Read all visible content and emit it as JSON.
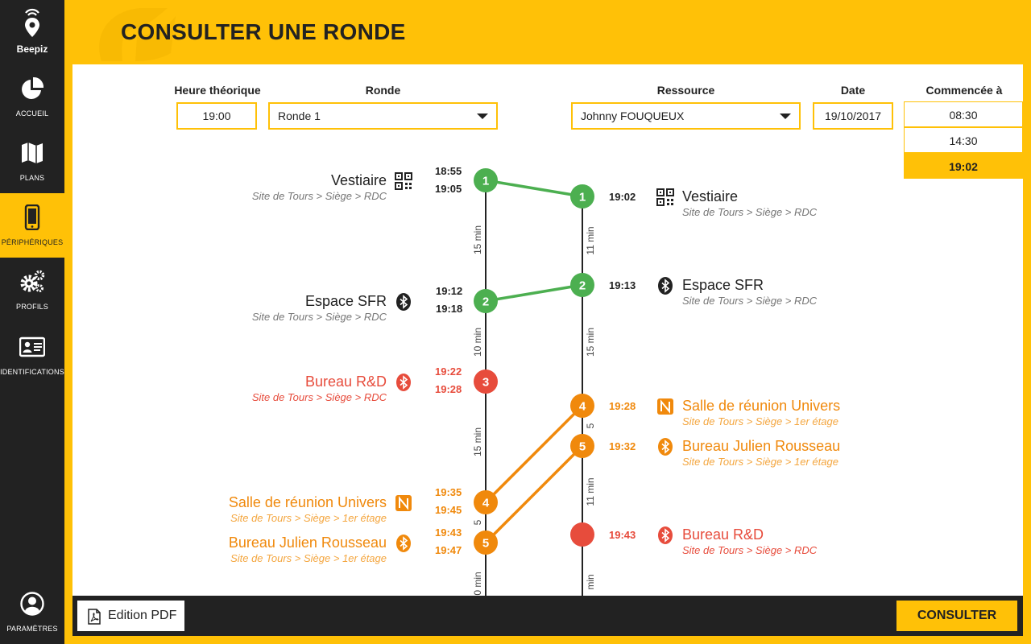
{
  "app": {
    "brand": "Beepiz",
    "page_title": "CONSULTER UNE RONDE"
  },
  "colors": {
    "accent": "#ffc107",
    "sidebar": "#222222",
    "ok": "#4caf50",
    "late": "#f0890c",
    "missed": "#e74c3c"
  },
  "sidebar": {
    "items": [
      {
        "label": "ACCUEIL",
        "icon": "pie-chart-icon"
      },
      {
        "label": "PLANS",
        "icon": "map-icon"
      },
      {
        "label": "PÉRIPHÉRIQUES",
        "icon": "smartphone-icon",
        "active": true
      },
      {
        "label": "PROFILS",
        "icon": "gears-icon"
      },
      {
        "label": "IDENTIFICATIONS",
        "icon": "id-card-icon"
      }
    ],
    "settings": {
      "label": "PARAMÈTRES",
      "icon": "user-circle-icon"
    }
  },
  "filters": {
    "heure": {
      "label": "Heure théorique",
      "value": "19:00"
    },
    "ronde": {
      "label": "Ronde",
      "value": "Ronde 1"
    },
    "ressource": {
      "label": "Ressource",
      "value": "Johnny FOUQUEUX"
    },
    "date": {
      "label": "Date",
      "value": "19/10/2017"
    },
    "commencee": {
      "label": "Commencée à",
      "options": [
        "08:30",
        "14:30",
        "19:02"
      ],
      "selected": "19:02"
    }
  },
  "timeline": {
    "planned": [
      {
        "num": "1",
        "status": "ok",
        "name": "Vestiaire",
        "path": "Site de Tours > Siège > RDC",
        "icon": "qr-code-icon",
        "time_from": "18:55",
        "time_to": "19:05"
      },
      {
        "num": "2",
        "status": "ok",
        "name": "Espace SFR",
        "path": "Site de Tours > Siège > RDC",
        "icon": "bluetooth-icon",
        "time_from": "19:12",
        "time_to": "19:18"
      },
      {
        "num": "3",
        "status": "missed",
        "name": "Bureau R&D",
        "path": "Site de Tours > Siège > RDC",
        "icon": "bluetooth-icon",
        "time_from": "19:22",
        "time_to": "19:28"
      },
      {
        "num": "4",
        "status": "late",
        "name": "Salle de réunion Univers",
        "path": "Site de Tours > Siège > 1er étage",
        "icon": "nfc-icon",
        "time_from": "19:35",
        "time_to": "19:45"
      },
      {
        "num": "5",
        "status": "late",
        "name": "Bureau Julien Rousseau",
        "path": "Site de Tours > Siège > 1er étage",
        "icon": "bluetooth-icon",
        "time_from": "19:43",
        "time_to": "19:47"
      }
    ],
    "planned_gaps": [
      "15 min",
      "10 min",
      "15 min",
      "5",
      "0 min"
    ],
    "actual": [
      {
        "num": "1",
        "status": "ok",
        "name": "Vestiaire",
        "path": "Site de Tours > Siège > RDC",
        "icon": "qr-code-icon",
        "time": "19:02"
      },
      {
        "num": "2",
        "status": "ok",
        "name": "Espace SFR",
        "path": "Site de Tours > Siège > RDC",
        "icon": "bluetooth-icon",
        "time": "19:13"
      },
      {
        "num": "4",
        "status": "late",
        "name": "Salle de réunion Univers",
        "path": "Site de Tours > Siège > 1er étage",
        "icon": "nfc-icon",
        "time": "19:28"
      },
      {
        "num": "5",
        "status": "late",
        "name": "Bureau Julien Rousseau",
        "path": "Site de Tours > Siège > 1er étage",
        "icon": "bluetooth-icon",
        "time": "19:32"
      },
      {
        "num": "",
        "status": "missed",
        "name": "Bureau R&D",
        "path": "Site de Tours > Siège > RDC",
        "icon": "bluetooth-icon",
        "time": "19:43"
      }
    ],
    "actual_gaps": [
      "11 min",
      "15 min",
      "5",
      "11 min",
      "min"
    ]
  },
  "footer": {
    "pdf_label": "Edition PDF",
    "consult_label": "CONSULTER"
  }
}
